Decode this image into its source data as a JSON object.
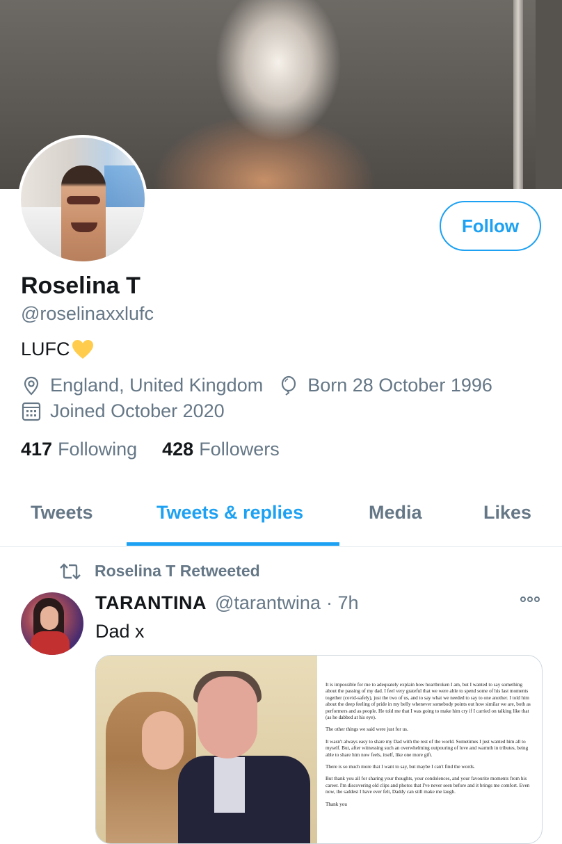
{
  "profile": {
    "name": "Roselina T",
    "handle": "@roselinaxxlufc",
    "bio": "LUFC",
    "location": "England, United Kingdom",
    "birthday": "Born 28 October 1996",
    "joined": "Joined October 2020",
    "following_count": "417",
    "following_label": "Following",
    "followers_count": "428",
    "followers_label": "Followers",
    "follow_label": "Follow"
  },
  "tabs": [
    {
      "label": "Tweets",
      "active": false
    },
    {
      "label": "Tweets & replies",
      "active": true
    },
    {
      "label": "Media",
      "active": false
    },
    {
      "label": "Likes",
      "active": false
    }
  ],
  "tweet": {
    "retweet_label": "Roselina T Retweeted",
    "author_name": "TARANTINA",
    "author_handle": "@tarantwina",
    "time": "· 7h",
    "text": "Dad x",
    "letter_paragraphs": [
      "It is impossible for me to adequately explain how heartbroken I am, but I wanted to say something about the passing of my dad. I feel very grateful that we were able to spend some of his last moments together (covid-safely), just the two of us, and to say what we needed to say to one another. I told him about the deep feeling of pride in my belly whenever somebody points out how similar we are, both as performers and as people. He told me that I was going to make him cry if I carried on talking like that (as he dabbed at his eye).",
      "The other things we said were just for us.",
      "It wasn't always easy to share my Dad with the rest of the world. Sometimes I just wanted him all to myself. But, after witnessing such an overwhelming outpouring of love and warmth in tributes, being able to share him now feels, itself, like one more gift.",
      "There is so much more that I want to say, but maybe I can't find the words.",
      "But thank you all for sharing your thoughts, your condolences, and your favourite moments from his career. I'm discovering old clips and photos that I've never seen before and it brings me comfort. Even now, the saddest I have ever felt, Daddy can still make me laugh.",
      "Thank you"
    ]
  },
  "colors": {
    "accent": "#1da1f2",
    "muted": "#657786",
    "text": "#14171a",
    "heart": "#ffcc4d"
  },
  "icons": [
    "location-pin-icon",
    "balloon-icon",
    "calendar-icon",
    "retweet-icon",
    "more-icon",
    "yellow-heart-icon"
  ]
}
